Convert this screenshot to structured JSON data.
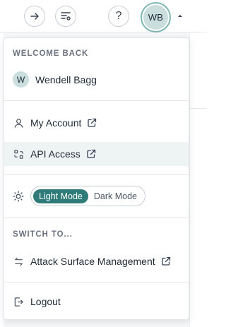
{
  "topbar": {
    "help_label": "?",
    "avatar_initials": "WB"
  },
  "menu": {
    "welcome_label": "WELCOME BACK",
    "user": {
      "initial": "W",
      "name": "Wendell Bagg"
    },
    "items": [
      {
        "label": "My Account",
        "icon": "person-icon",
        "external": true
      },
      {
        "label": "API Access",
        "icon": "api-icon",
        "external": true
      }
    ],
    "theme": {
      "light_label": "Light Mode",
      "dark_label": "Dark Mode",
      "selected": "Light Mode"
    },
    "switch_label": "SWITCH TO...",
    "switch_item": {
      "label": "Attack Surface Management",
      "icon": "swap-icon",
      "external": true
    },
    "logout_label": "Logout"
  },
  "colors": {
    "accent": "#2f7b79",
    "avatar_bg": "#c9dedd",
    "hover_bg": "#eef4f4"
  }
}
